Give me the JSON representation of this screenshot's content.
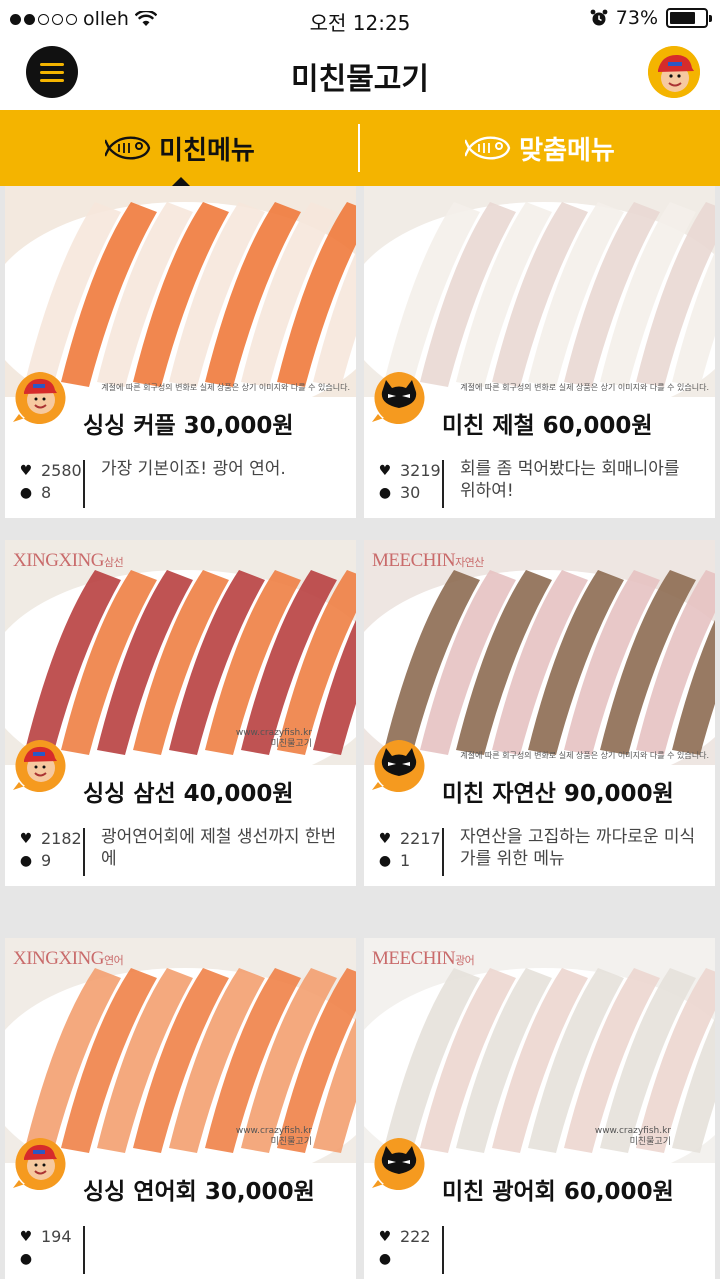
{
  "status_bar": {
    "carrier": "olleh",
    "time": "오전 12:25",
    "battery": "73%",
    "battery_level": 0.73,
    "signal_bars_filled": 2,
    "signal_bars_total": 5
  },
  "nav": {
    "title": "미친물고기"
  },
  "tabs": [
    {
      "label": "미친메뉴",
      "active": true
    },
    {
      "label": "맞춤메뉴",
      "active": false
    }
  ],
  "colors": {
    "accent": "#f4b400",
    "badge_orange": "#f59a1f"
  },
  "cards": [
    {
      "title": "싱싱 커플 30,000원",
      "likes": "2580",
      "comments": "8",
      "description": "가장 기본이죠! 광어 연어.",
      "badge": "red-cap-character-icon",
      "note": "계절에 따른 회구성의 변화로 실제 상품은 상기 이미지와 다를 수 있습니다."
    },
    {
      "title": "미친 제철 60,000원",
      "likes": "3219",
      "comments": "30",
      "description": "회를 좀 먹어봤다는 회매니아를 위하여!",
      "badge": "black-cat-character-icon",
      "note": "계절에 따른 회구성의 변화로 실제 상품은 상기 이미지와 다를 수 있습니다."
    },
    {
      "title": "싱싱 삼선 40,000원",
      "likes": "2182",
      "comments": "9",
      "description": "광어연어회에 제철 생선까지 한번에",
      "badge": "red-cap-character-icon",
      "brand": "XINGXING",
      "brand_sub": "삼선",
      "url": "www.crazyfish.kr",
      "logo_text": "미친물고기"
    },
    {
      "title": "미친 자연산 90,000원",
      "likes": "2217",
      "comments": "1",
      "description": "자연산을 고집하는 까다로운 미식가를 위한 메뉴",
      "badge": "black-cat-character-icon",
      "brand": "MEECHIN",
      "brand_sub": "자연산",
      "note": "계절에 따른 회구성의 변화로 실제 상품은 상기 이미지와 다를 수 있습니다."
    },
    {
      "title": "싱싱 연어회 30,000원",
      "likes": "194",
      "comments": "",
      "description": "",
      "badge": "red-cap-character-icon",
      "brand": "XINGXING",
      "brand_sub": "연어",
      "url": "www.crazyfish.kr",
      "logo_text": "미친물고기"
    },
    {
      "title": "미친 광어회 60,000원",
      "likes": "222",
      "comments": "",
      "description": "",
      "badge": "black-cat-character-icon",
      "brand": "MEECHIN",
      "brand_sub": "광어",
      "url": "www.crazyfish.kr",
      "logo_text": "미친물고기"
    }
  ]
}
